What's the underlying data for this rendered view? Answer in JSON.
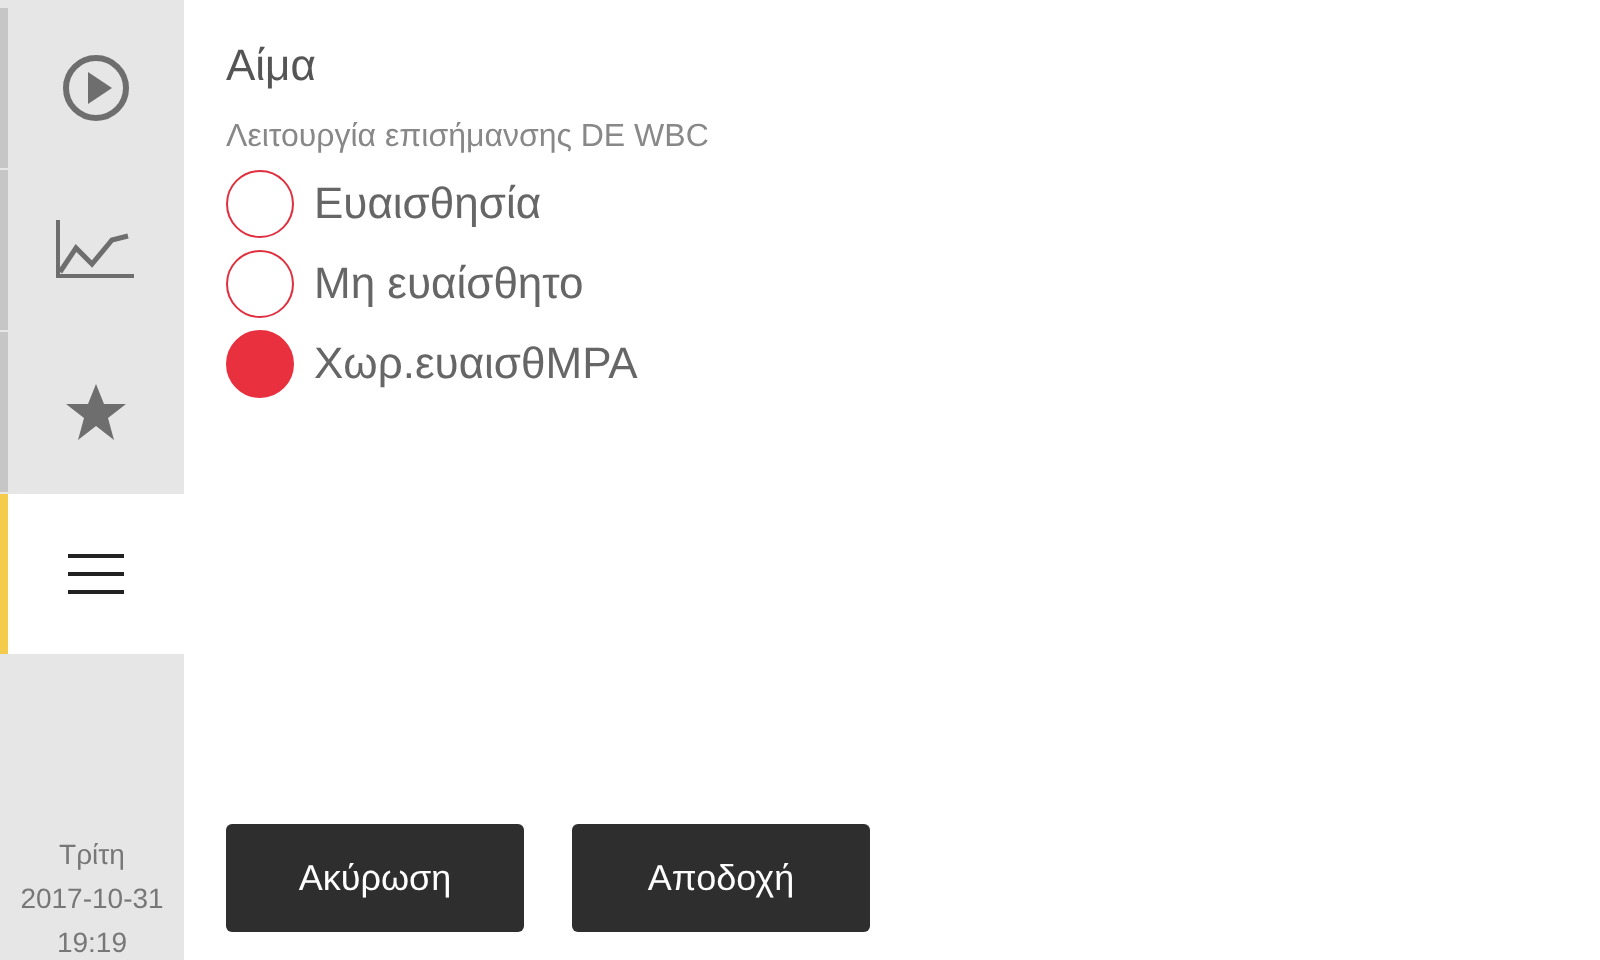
{
  "sidebar": {
    "tabs": [
      {
        "kind": "play",
        "selected": false
      },
      {
        "kind": "chart",
        "selected": false
      },
      {
        "kind": "star",
        "selected": false
      },
      {
        "kind": "menu",
        "selected": true
      }
    ],
    "day": "Τρίτη",
    "date": "2017-10-31",
    "time": "19:19"
  },
  "title": "Αίμα",
  "subtitle": "Λειτουργία επισήμανσης DE WBC",
  "options": [
    {
      "label": "Ευαισθησία",
      "selected": false
    },
    {
      "label": "Μη ευαίσθητο",
      "selected": false
    },
    {
      "label": "Χωρ.ευαισθMPA",
      "selected": true
    }
  ],
  "buttons": [
    "Ακύρωση",
    "Αποδοχή"
  ]
}
